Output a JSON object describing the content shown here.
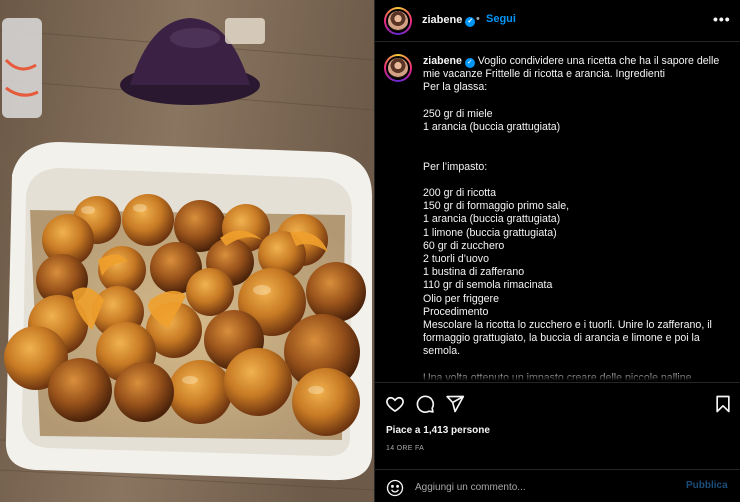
{
  "post": {
    "username": "ziabene",
    "follow_label": "Segui",
    "dot_separator": "•",
    "more_glyph": "•••",
    "verified_glyph": "✓",
    "caption_text": " Voglio condividere una ricetta che ha il sapore delle mie vacanze Frittelle di ricotta e arancia. Ingredienti\nPer la glassa:\n\n250 gr di miele\n1 arancia (buccia grattugiata)\n\n\nPer l’impasto:\n\n200 gr di ricotta\n150 gr di formaggio primo sale,\n1 arancia (buccia grattugiata)\n1 limone (buccia grattugiata)\n60 gr di zucchero\n2 tuorli d’uovo\n1 bustina di zafferano\n110 gr di semola rimacinata\nOlio per friggere\nProcedimento\nMescolare la ricotta lo zucchero e i tuorli. Unire lo zafferano, il formaggio grattugiato, la buccia di arancia e limone e poi la semola.\n\nUna volta ottenuto un impasto creare delle piccole palline",
    "likes_text": "Piace a 1,413 persone",
    "timestamp": "14 ORE FA",
    "comment_placeholder": "Aggiungi un commento...",
    "publish_label": "Pubblica"
  },
  "icons": {
    "like": "heart-icon",
    "comment": "comment-bubble-icon",
    "share": "paper-plane-icon",
    "save": "bookmark-icon",
    "emoji": "smiley-icon",
    "more": "more-options-icon",
    "verified": "verified-badge-icon"
  },
  "colors": {
    "background": "#000000",
    "text": "#f5f5f5",
    "muted": "#a8a8a8",
    "link_blue": "#0095f6",
    "divider": "#262626",
    "publish_disabled": "#1b4d7a"
  }
}
